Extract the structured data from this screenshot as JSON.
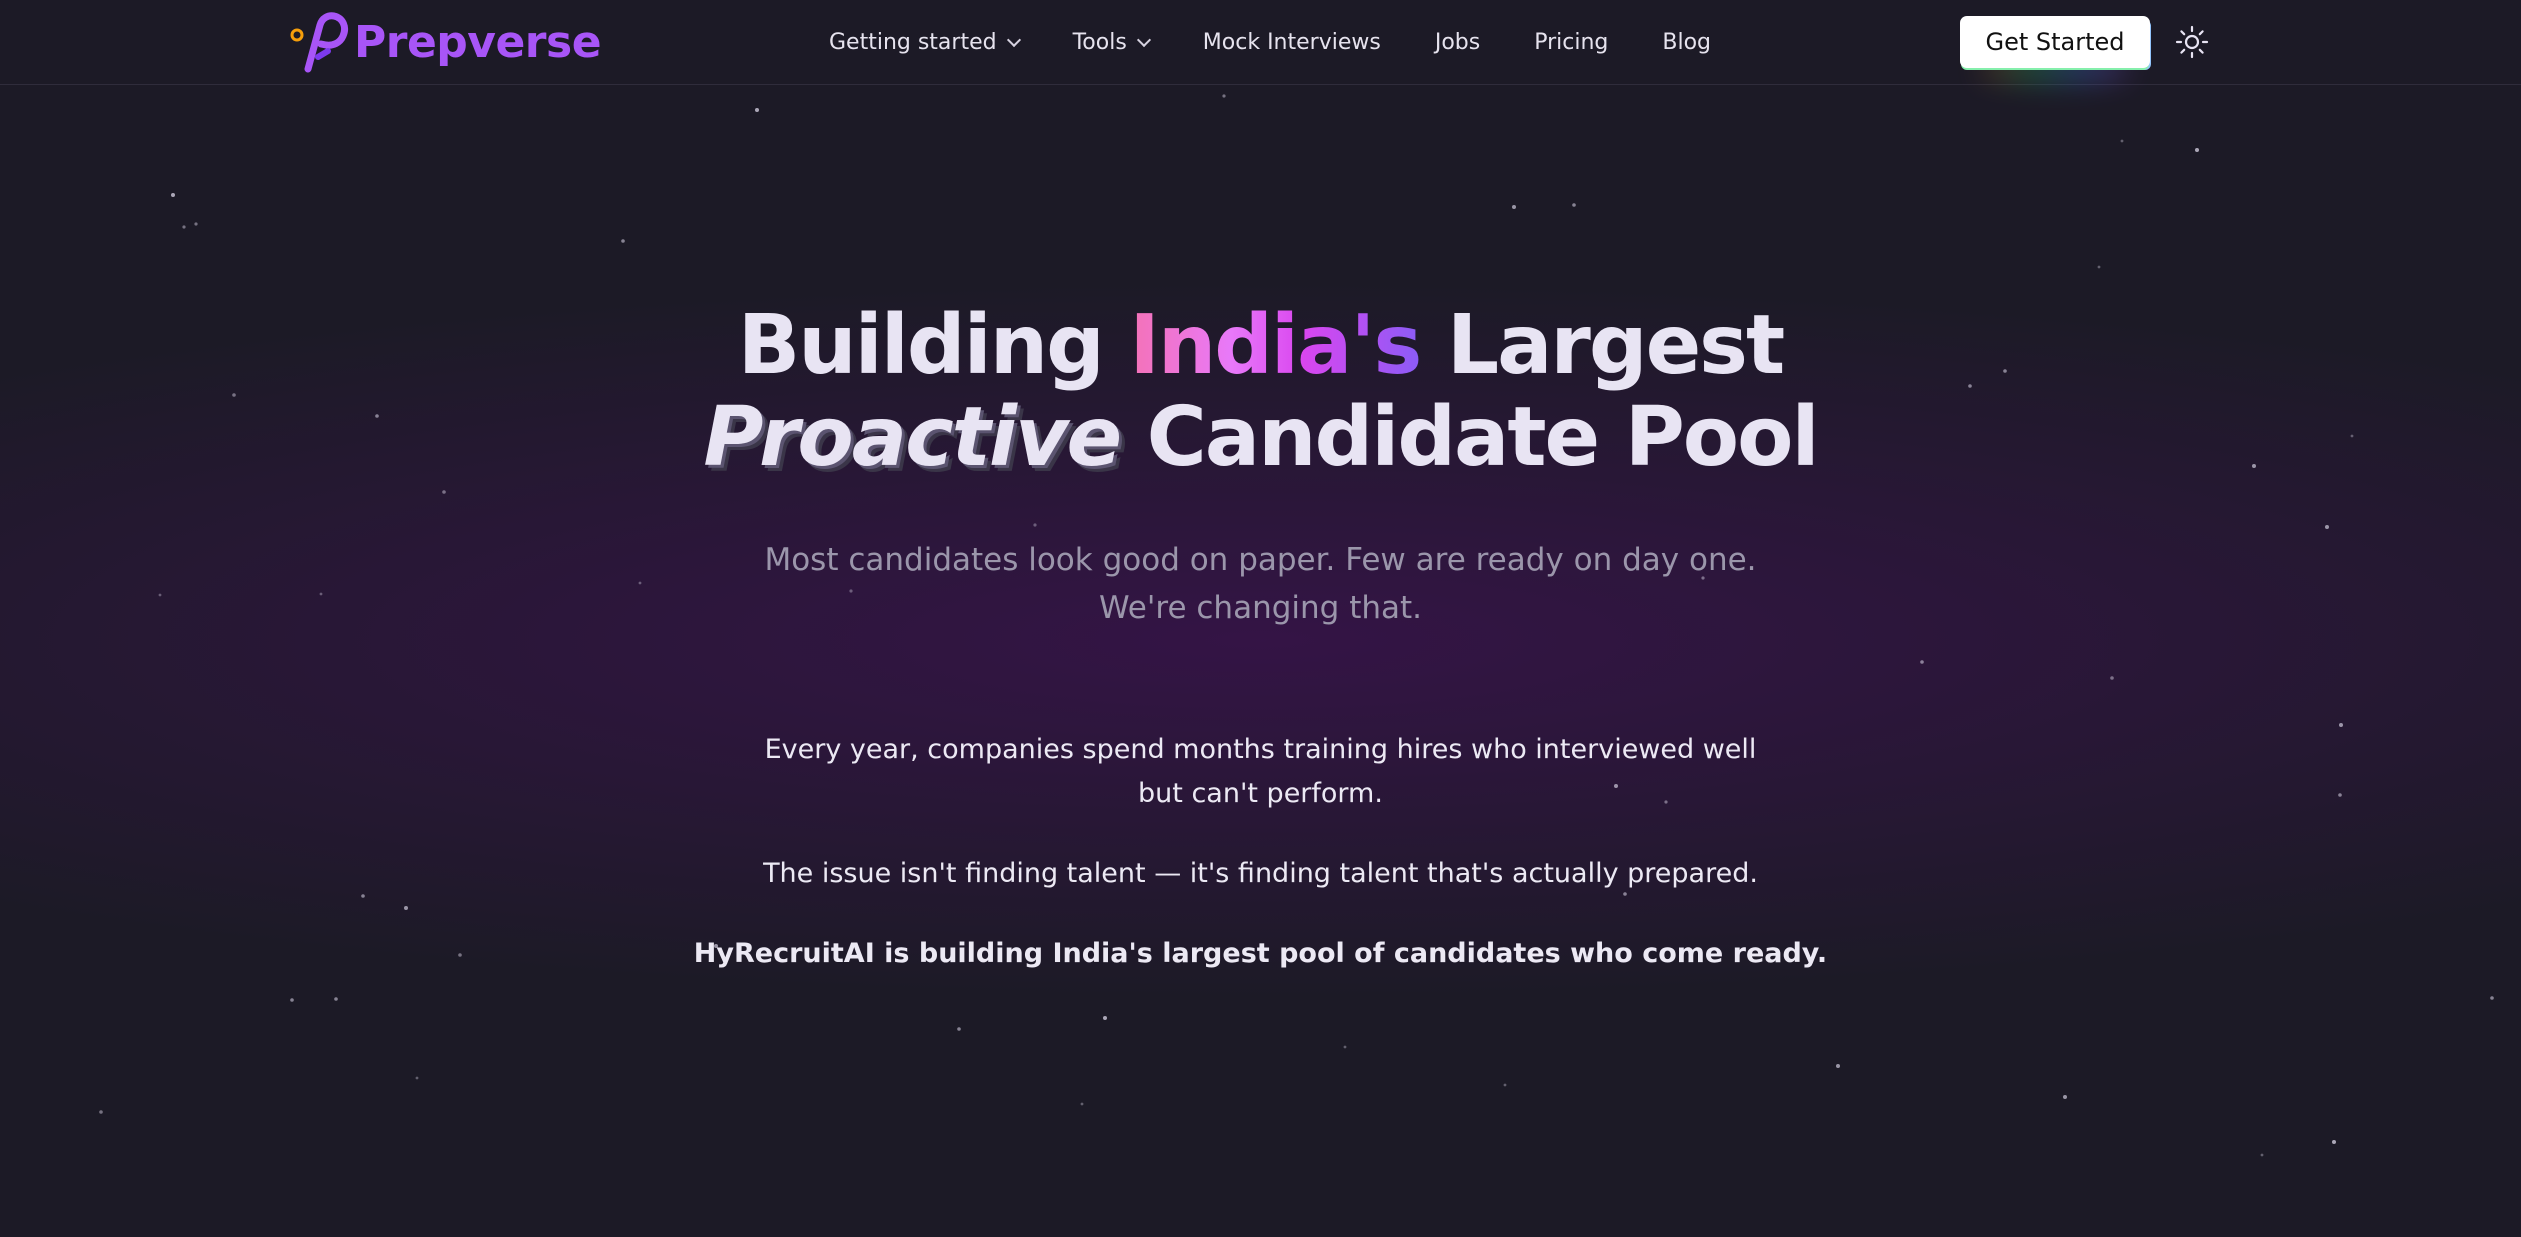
{
  "header": {
    "brand_name": "Prepverse",
    "nav": [
      {
        "label": "Getting started",
        "has_dropdown": true
      },
      {
        "label": "Tools",
        "has_dropdown": true
      },
      {
        "label": "Mock Interviews",
        "has_dropdown": false
      },
      {
        "label": "Jobs",
        "has_dropdown": false
      },
      {
        "label": "Pricing",
        "has_dropdown": false
      },
      {
        "label": "Blog",
        "has_dropdown": false
      }
    ],
    "cta_label": "Get Started",
    "theme_toggle_icon": "sun-icon"
  },
  "hero": {
    "title_line1_part1": "Building",
    "title_line1_accent": "India's",
    "title_line1_part2": "Largest",
    "title_line2_italic": "Proactive",
    "title_line2_rest": "Candidate Pool",
    "subtitle_line1": "Most candidates look good on paper. Few are ready on day one.",
    "subtitle_line2": "We're changing that.",
    "paragraph1_line1": "Every year, companies spend months training hires who interviewed well",
    "paragraph1_line2": "but can't perform.",
    "paragraph2": "The issue isn't finding talent — it's finding talent that's actually prepared.",
    "paragraph3": "HyRecruitAI is building India's largest pool of candidates who come ready."
  },
  "colors": {
    "background": "#1c1a26",
    "brand": "#a855f7",
    "heading": "#e8e4f3",
    "accent_gradient_start": "#f472b6",
    "accent_gradient_end": "#8b5cf6",
    "subtitle": "#9b96ab"
  }
}
